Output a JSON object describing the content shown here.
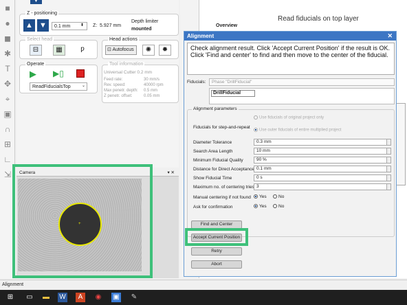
{
  "z_panel": {
    "title": "Z - positioning",
    "step_value": "0.1 mm",
    "z_label": "Z:",
    "z_value": "5.927 mm",
    "depth_limiter_label": "Depth limiter",
    "depth_limiter_value": "mounted"
  },
  "select_head": {
    "title": "Select head"
  },
  "head_actions": {
    "title": "Head actions",
    "autofocus_label": "Autofocus"
  },
  "operate": {
    "title": "Operate",
    "selected_operation": "ReadFiducialsTop"
  },
  "tool_info": {
    "title": "Tool information",
    "tool_name": "Universal Cutter 0.2 mm",
    "rows": [
      {
        "label": "Feed rate:",
        "value": "30 mm/s"
      },
      {
        "label": "Rev. speed:",
        "value": "40000 rpm"
      },
      {
        "label": "Max penetr. depth:",
        "value": "0.5 mm"
      },
      {
        "label": "Z penetr. offset:",
        "value": "0.05 mm"
      }
    ]
  },
  "camera": {
    "title": "Camera",
    "controls": "▾ ✕"
  },
  "background": {
    "overview_label": "Overview",
    "header_text": "Read fiducials on top layer"
  },
  "dialog": {
    "title": "Alignment",
    "message": "Check alignment result. Click 'Accept Current Position' if the result is OK. Click 'Find and center' to find and then move to the center of the fiducial.",
    "fiducials_label": "Fiducials:",
    "fiducials_select": "Phase \"DrillFiducial\"",
    "fiducial_item": "DrillFiducial",
    "params_title": "Alignment parameters",
    "step_repeat_label": "Fiducials for step-and-repeat",
    "step_repeat_opt1": "Use fiducials of original project only",
    "step_repeat_opt2": "Use outer fiducials of entire multiplied project",
    "params": [
      {
        "label": "Diameter Tolerance",
        "value": "0.3 mm"
      },
      {
        "label": "Search Area Length",
        "value": "10 mm"
      },
      {
        "label": "Minimum Fiducial Quality",
        "value": "90 %"
      },
      {
        "label": "Distance for Direct Acceptance",
        "value": "0.1 mm"
      },
      {
        "label": "Show Fiducial Time",
        "value": "0 s"
      },
      {
        "label": "Maximum no. of centering tries",
        "value": "3"
      }
    ],
    "manual_label": "Manual centering if not found",
    "confirm_label": "Ask for confirmation",
    "yes": "Yes",
    "no": "No",
    "buttons": {
      "find": "Find and Center",
      "accept": "Accept Current Position",
      "retry": "Retry",
      "abort": "Abort"
    }
  },
  "status_bar": {
    "text": "Alignment"
  },
  "colors": {
    "highlight": "#3ec07a",
    "title_bar": "#3c76c4",
    "fiducial_ring": "#e8e800"
  }
}
